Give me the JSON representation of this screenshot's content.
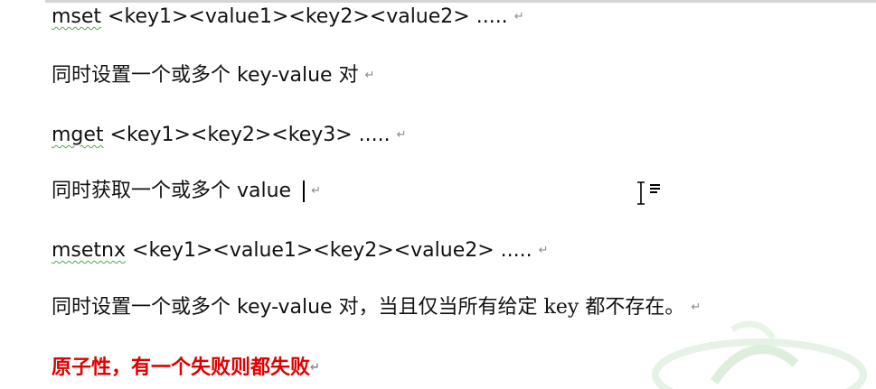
{
  "lines": [
    {
      "cmd": "mset",
      "rest": " <key1><value1><key2><value2>  .....",
      "mark": "↵"
    },
    {
      "text": "同时设置一个或多个 key-value 对 ",
      "mark": "↵"
    },
    {
      "cmd": "mget",
      "rest": " <key1><key2><key3> .....",
      "mark": "↵"
    },
    {
      "text": "同时获取一个或多个 value ",
      "mark": "↵"
    },
    {
      "cmd": "msetnx",
      "rest": " <key1><value1><key2><value2>  .....",
      "mark": "↵"
    },
    {
      "text_a": "同时设置一个或多个 key-value 对，当且仅当所有给定 ",
      "text_b": "key",
      "text_c": " 都不存在。",
      "mark": "↵"
    },
    {
      "text": "原子性，有一个失败则都失败",
      "mark": "↵"
    }
  ],
  "colors": {
    "emphasis": "#e00000",
    "spellcheck_underline": "#4ea84e",
    "paragraph_mark": "#8a8a8a"
  },
  "icons": {
    "cursor": "i-beam-cursor",
    "watermark": "faint-green-watermark"
  }
}
